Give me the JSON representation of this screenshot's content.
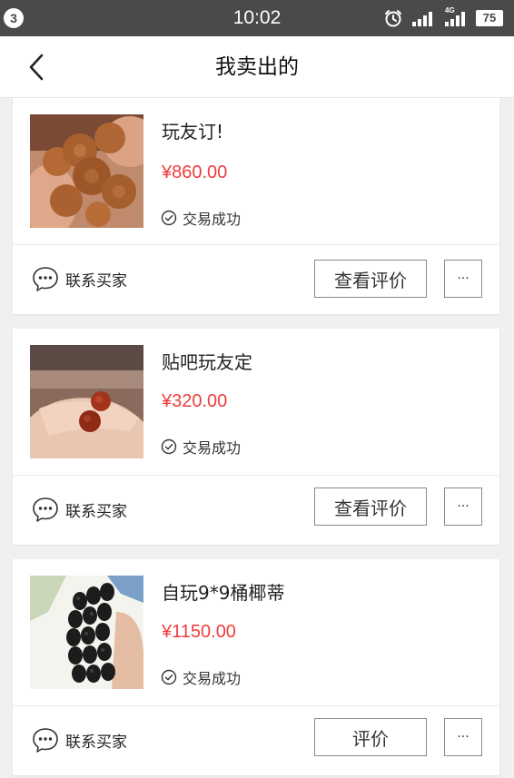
{
  "status_bar": {
    "notification_count": "3",
    "time": "10:02",
    "network1": "",
    "network2": "4G",
    "battery": "75",
    "icons": [
      "alarm-icon",
      "signal-icon",
      "signal-4g-icon",
      "battery-icon"
    ]
  },
  "header": {
    "title": "我卖出的",
    "back_icon": "chevron-left-icon"
  },
  "orders": [
    {
      "title": "玩友订!",
      "price": "¥860.00",
      "status": "交易成功",
      "contact_label": "联系买家",
      "review_label": "查看评价",
      "more_label": "···"
    },
    {
      "title": "贴吧玩友定",
      "price": "¥320.00",
      "status": "交易成功",
      "contact_label": "联系买家",
      "review_label": "查看评价",
      "more_label": "···"
    },
    {
      "title": "自玩9*9桶椰蒂",
      "price": "¥1150.00",
      "status": "交易成功",
      "contact_label": "联系买家",
      "review_label": "评价",
      "more_label": "···"
    }
  ],
  "colors": {
    "price": "#f03c3c",
    "status_bar": "#4a4a4c",
    "background": "#f0f0f2"
  }
}
